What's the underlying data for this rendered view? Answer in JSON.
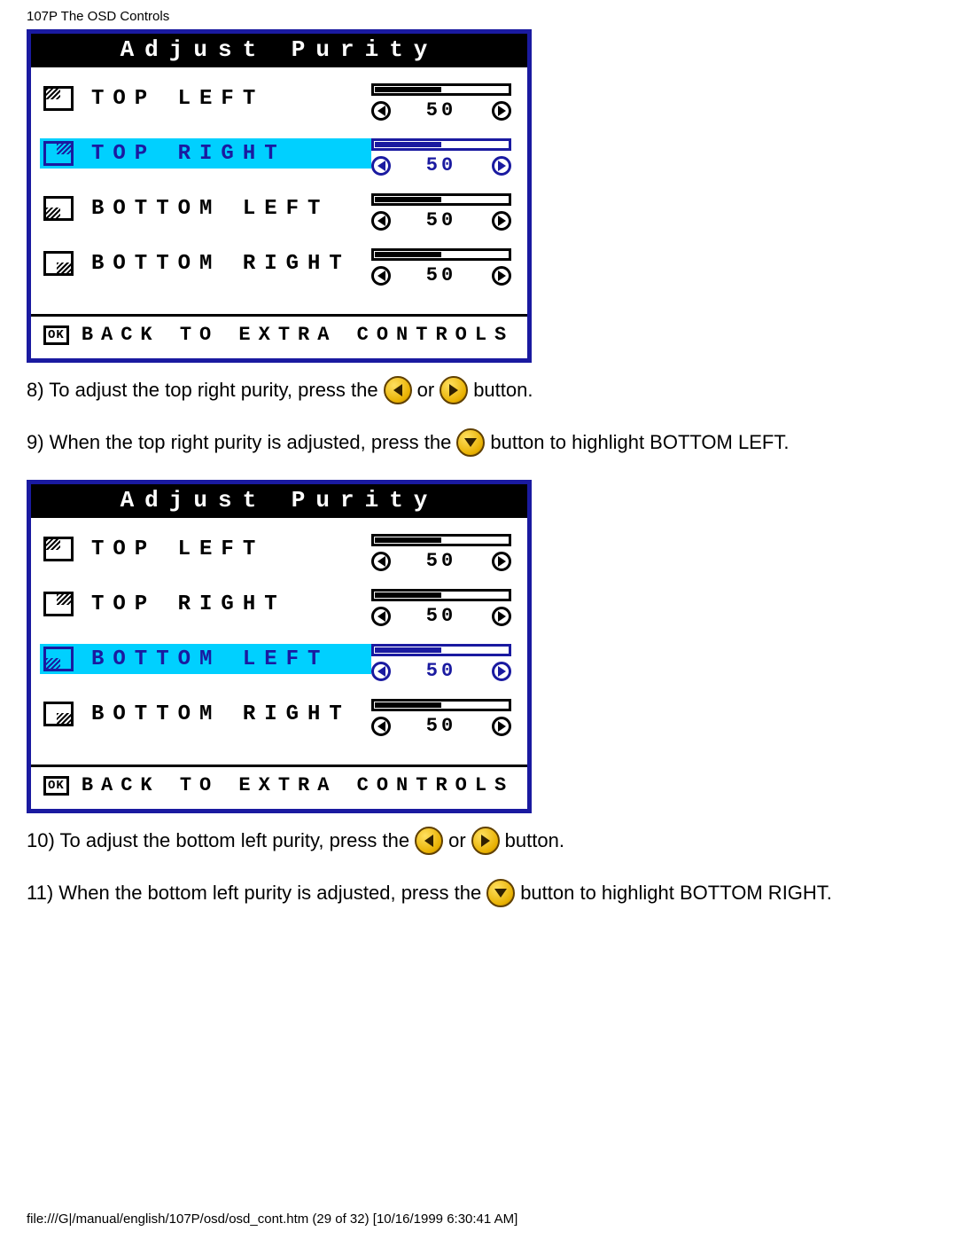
{
  "header": "107P The OSD Controls",
  "osd": {
    "title": "Adjust Purity",
    "footer": "BACK TO EXTRA CONTROLS",
    "items": [
      {
        "label": "TOP LEFT",
        "value": "50",
        "fill": 50,
        "corner": "tl"
      },
      {
        "label": "TOP RIGHT",
        "value": "50",
        "fill": 50,
        "corner": "tr"
      },
      {
        "label": "BOTTOM LEFT",
        "value": "50",
        "fill": 50,
        "corner": "bl"
      },
      {
        "label": "BOTTOM RIGHT",
        "value": "50",
        "fill": 50,
        "corner": "br"
      }
    ]
  },
  "panel1_highlight_index": 1,
  "panel2_highlight_index": 2,
  "instructions": {
    "i8a": "8) To adjust the top right purity, press the",
    "or": "or",
    "i8b": "button.",
    "i9a": "9) When the top right purity is adjusted, press the",
    "i9b": "button to highlight BOTTOM LEFT.",
    "i10a": "10) To adjust the bottom left purity, press the",
    "i10b": "button.",
    "i11a": "11) When the bottom left purity is adjusted, press the",
    "i11b": "button to highlight BOTTOM RIGHT."
  },
  "ok_label": "OK",
  "footer_line": "file:///G|/manual/english/107P/osd/osd_cont.htm (29 of 32) [10/16/1999 6:30:41 AM]"
}
